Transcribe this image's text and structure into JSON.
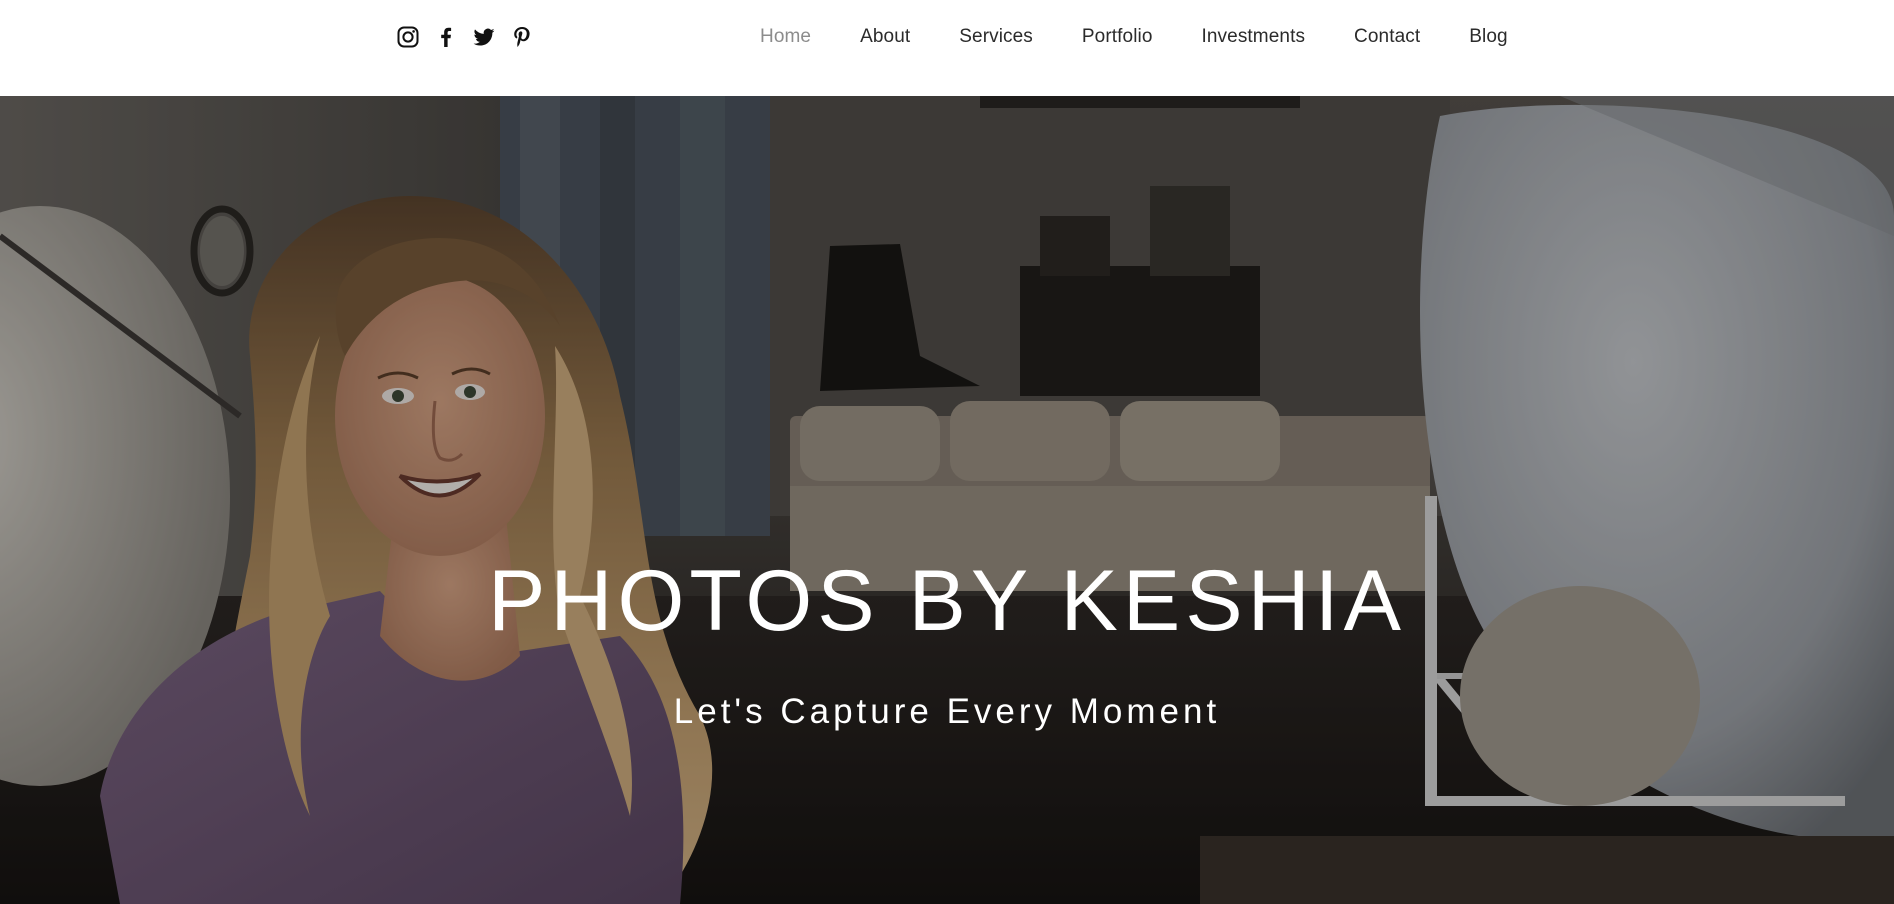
{
  "colors": {
    "nav_text": "#2b2b2b",
    "nav_active": "#8c8c8c",
    "hero_text": "#ffffff",
    "header_bg": "#ffffff"
  },
  "social": [
    {
      "name": "instagram-icon",
      "label": "Instagram"
    },
    {
      "name": "facebook-icon",
      "label": "Facebook"
    },
    {
      "name": "twitter-icon",
      "label": "Twitter"
    },
    {
      "name": "pinterest-icon",
      "label": "Pinterest"
    }
  ],
  "nav": {
    "active": "Home",
    "items": [
      {
        "label": "Home"
      },
      {
        "label": "About"
      },
      {
        "label": "Services"
      },
      {
        "label": "Portfolio"
      },
      {
        "label": "Investments"
      },
      {
        "label": "Contact"
      },
      {
        "label": "Blog"
      }
    ]
  },
  "hero": {
    "title": "PHOTOS BY KESHIA",
    "subtitle": "Let's Capture Every Moment",
    "image_subject": "portrait of a smiling woman with long wavy blonde hair in a purple t-shirt, photo studio background"
  }
}
